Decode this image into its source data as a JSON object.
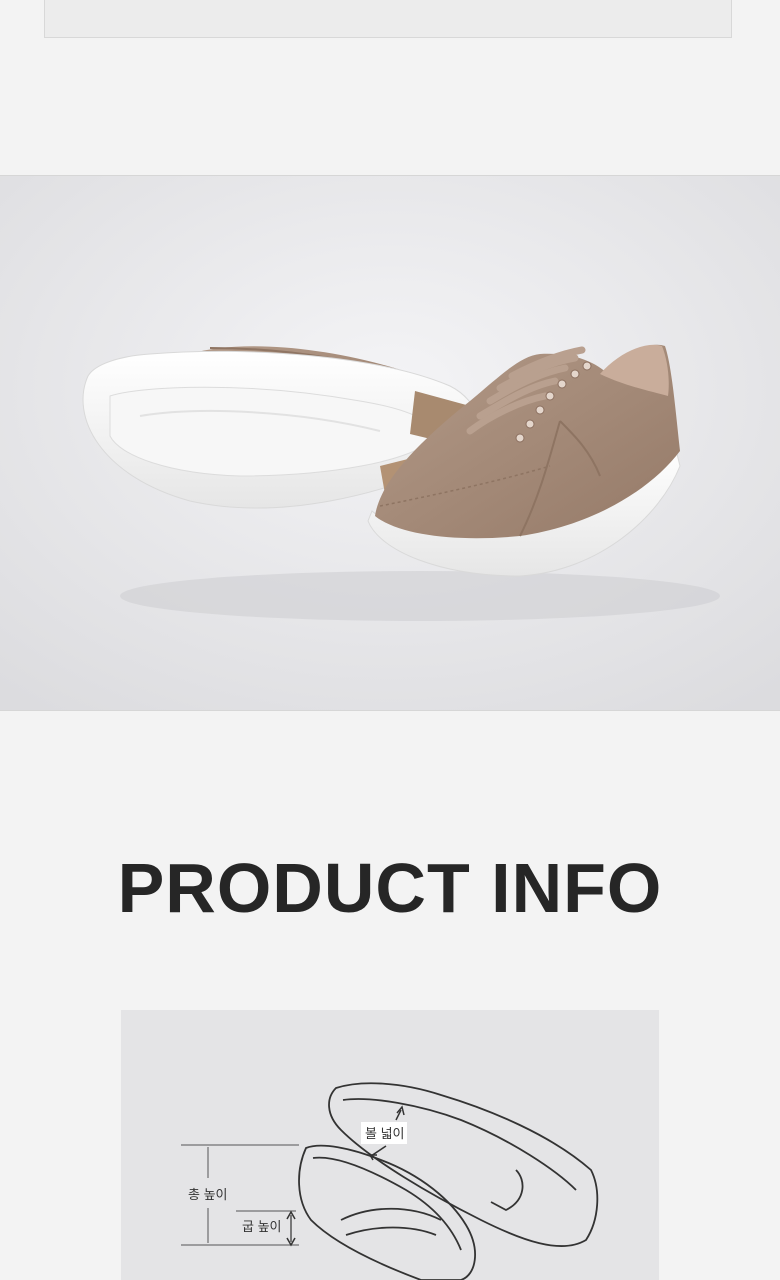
{
  "section": {
    "title": "PRODUCT INFO"
  },
  "photo": {
    "description_icon": "sneaker-photo",
    "colors": {
      "upper": "#a58a77",
      "sole": "#ffffff",
      "background": "#e8e8ea"
    }
  },
  "diagram": {
    "labels": {
      "total_height": "총 높이",
      "heel_height": "굽 높이",
      "ball_width": "볼 넓이"
    }
  }
}
